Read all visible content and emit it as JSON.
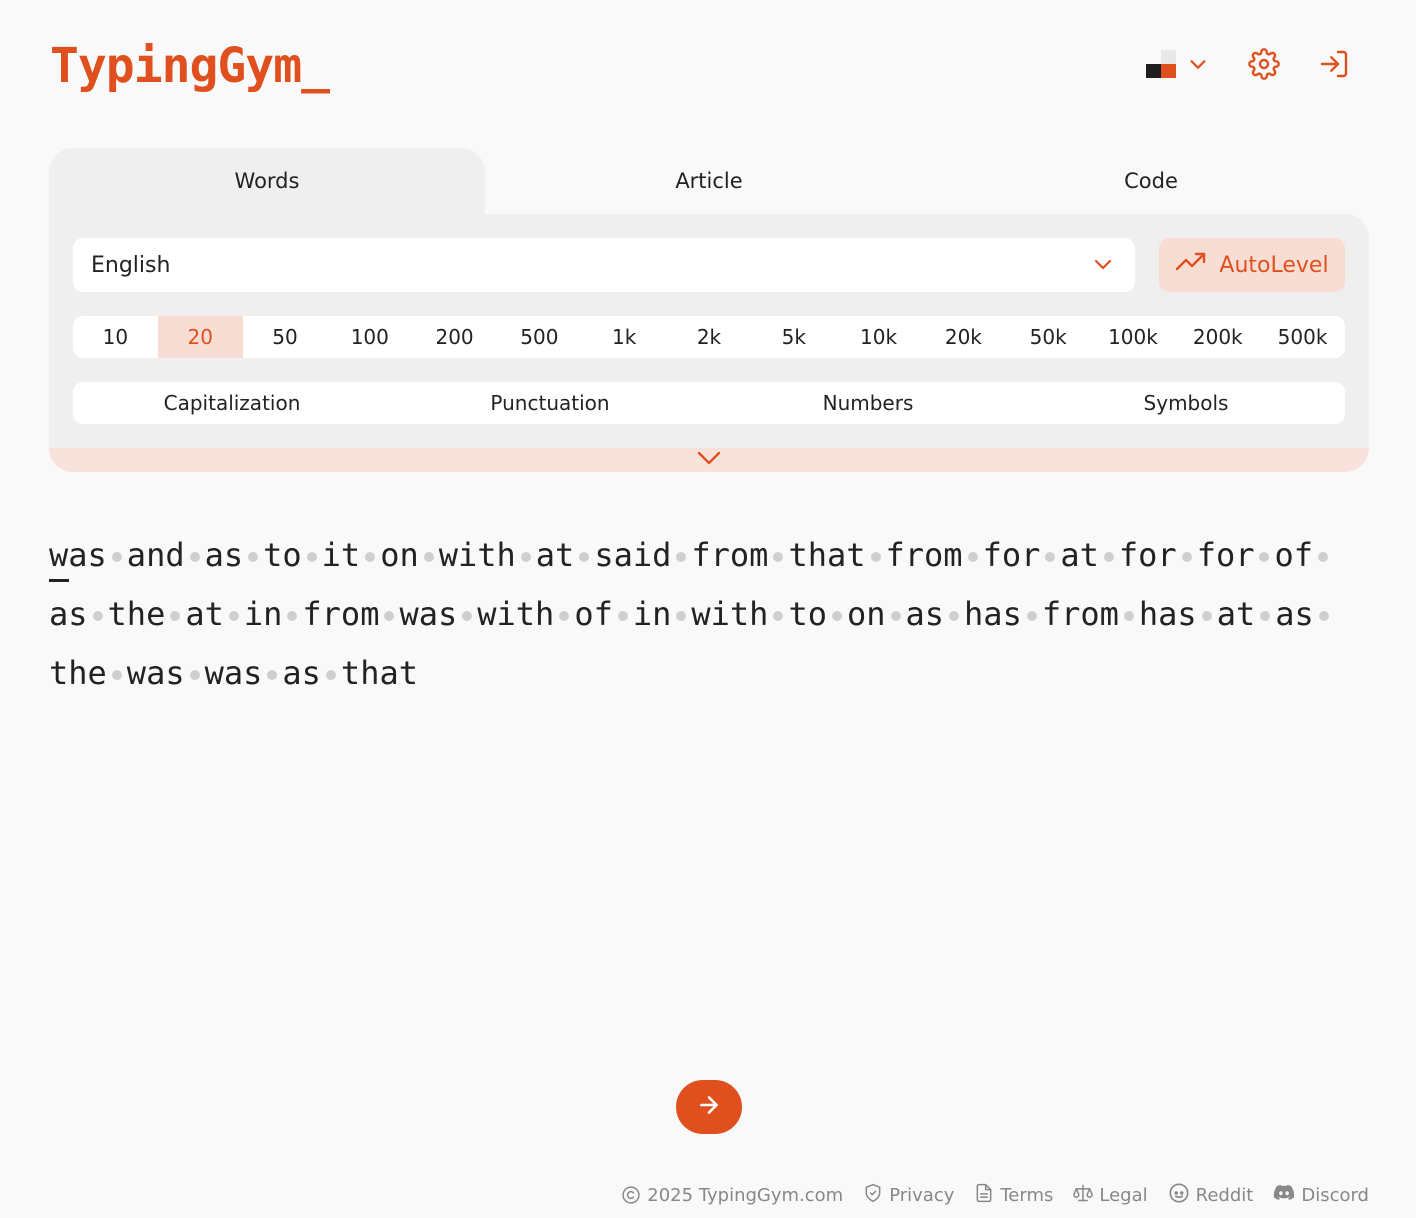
{
  "header": {
    "logo": "TypingGym_",
    "theme_icon": "theme-swatch-icon",
    "settings_icon": "gear-icon",
    "login_icon": "sign-in-icon"
  },
  "mode_tabs": [
    {
      "label": "Words",
      "active": true
    },
    {
      "label": "Article",
      "active": false
    },
    {
      "label": "Code",
      "active": false
    }
  ],
  "language_select": {
    "value": "English"
  },
  "autolevel": {
    "label": "AutoLevel",
    "icon": "trending-up-icon"
  },
  "word_counts": {
    "options": [
      "10",
      "20",
      "50",
      "100",
      "200",
      "500",
      "1k",
      "2k",
      "5k",
      "10k",
      "20k",
      "50k",
      "100k",
      "200k",
      "500k"
    ],
    "selected": "20"
  },
  "modifiers": [
    "Capitalization",
    "Punctuation",
    "Numbers",
    "Symbols"
  ],
  "typing_text": {
    "words": [
      "was",
      "and",
      "as",
      "to",
      "it",
      "on",
      "with",
      "at",
      "said",
      "from",
      "that",
      "from",
      "for",
      "at",
      "for",
      "for",
      "of",
      "as",
      "the",
      "at",
      "in",
      "from",
      "was",
      "with",
      "of",
      "in",
      "with",
      "to",
      "on",
      "as",
      "has",
      "from",
      "has",
      "at",
      "as",
      "the",
      "was",
      "was",
      "as",
      "that"
    ],
    "line_breaks_after": [
      16,
      34
    ]
  },
  "next_button": {
    "icon": "arrow-right-icon"
  },
  "footer": {
    "copyright": "2025 TypingGym.com",
    "links": [
      "Privacy",
      "Terms",
      "Legal",
      "Reddit",
      "Discord"
    ]
  },
  "colors": {
    "accent": "#e0501f",
    "accent_soft": "#f8ddd4",
    "panel_bg": "#efefef",
    "page_bg": "#f9f9f9"
  }
}
